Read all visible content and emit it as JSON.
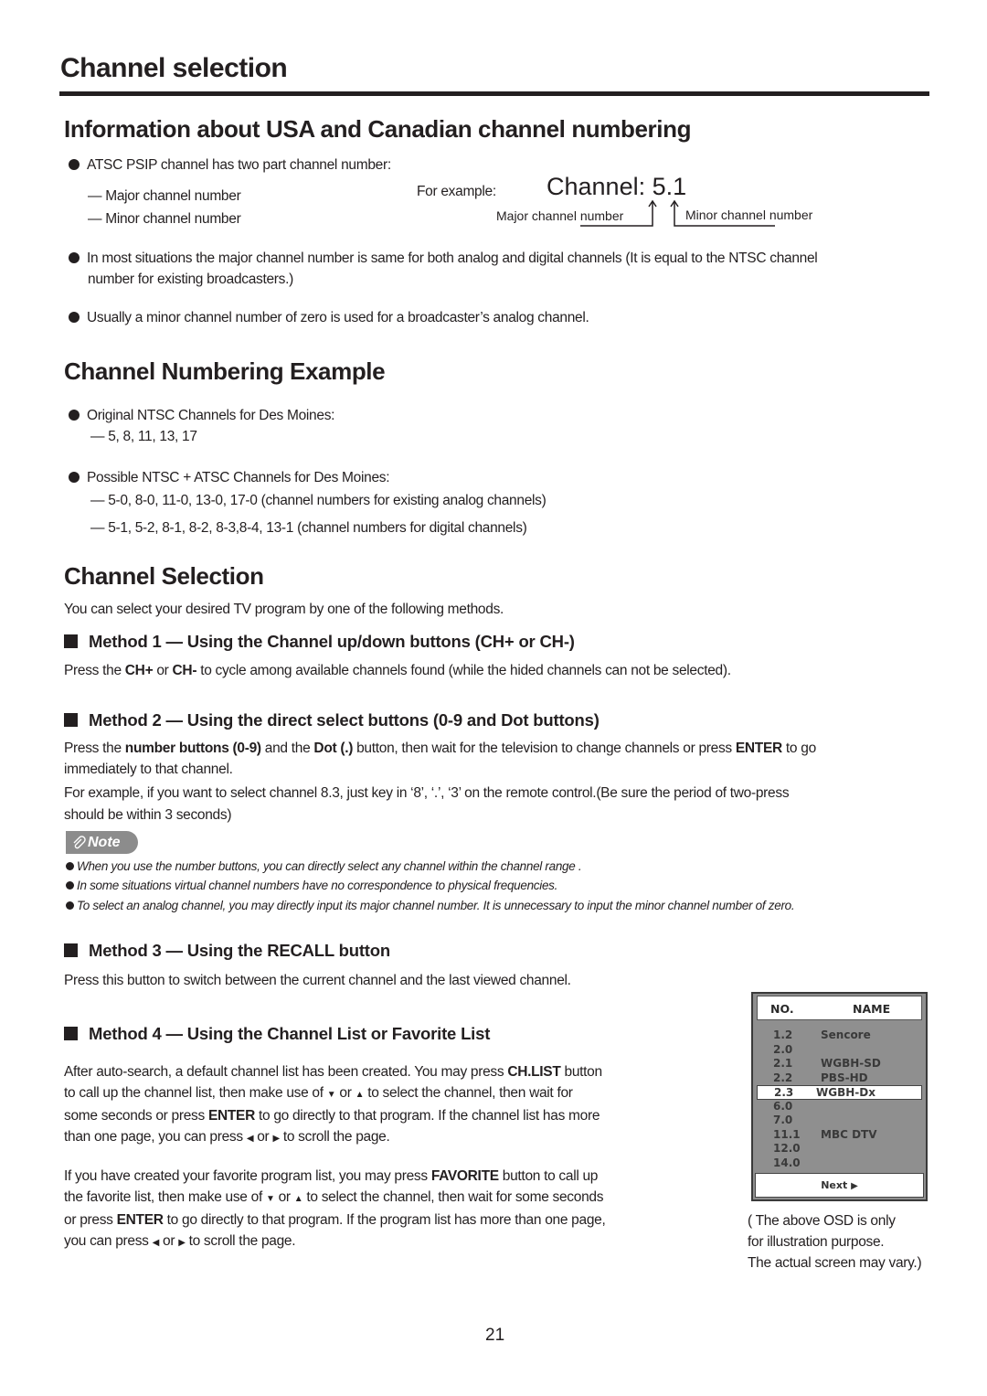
{
  "page": {
    "title": "Channel selection",
    "page_number": "21"
  },
  "section1": {
    "heading": "Information about USA and Canadian channel numbering",
    "bullet1": "ATSC PSIP channel has two part channel number:",
    "dash1": "— Major channel number",
    "dash2": "—  Minor channel number",
    "example_label": "For example:",
    "example_value": "Channel: 5.1",
    "major_label": "Major channel number",
    "minor_label": "Minor channel number",
    "bullet2_line1": "In most situations the major channel number is same for both analog and digital channels (It is equal to the NTSC channel",
    "bullet2_line2": "number for existing broadcasters.)",
    "bullet3": "Usually a minor channel number of zero is used for a broadcaster’s analog channel."
  },
  "section2": {
    "heading": "Channel Numbering Example",
    "bullet1": "Original NTSC Channels for Des Moines:",
    "bullet1_dash": "— 5, 8, 11, 13, 17",
    "bullet2": "Possible NTSC + ATSC Channels for Des Moines:",
    "bullet2_dash1": "—  5-0, 8-0, 11-0, 13-0, 17-0 (channel numbers for existing analog channels)",
    "bullet2_dash2": "—  5-1, 5-2,  8-1, 8-2, 8-3,8-4, 13-1 (channel numbers for digital channels)"
  },
  "section3": {
    "heading": "Channel Selection",
    "intro": "You can select your desired TV program by one of the following methods.",
    "method1": {
      "heading": "Method 1 —  Using the Channel up/down buttons (CH+ or CH-)",
      "t1": "Press the ",
      "b1": "CH+",
      "t2": " or ",
      "b2": "CH-",
      "t3": " to cycle among available channels found (while the hided channels can not be selected)."
    },
    "method2": {
      "heading": "Method 2 —  Using the direct select buttons (0-9 and Dot buttons)",
      "t1": "Press the ",
      "b1": "number buttons (0-9)",
      "t2": " and the ",
      "b2": "Dot (.)",
      "t3": " button, then wait for the television to change channels or press ",
      "b3": "ENTER",
      "t4": " to go",
      "line2": "immediately to that channel.",
      "line3": "For example, if you want to select channel 8.3,   just key in ‘8’, ‘.’, ‘3’ on the remote control.(Be sure the period of two-press",
      "line4": "should be within 3 seconds)"
    },
    "note": {
      "badge": "Note",
      "items": [
        "When you use the number buttons, you can directly select  any channel  within the channel  range .",
        "In some situations virtual channel numbers have no correspondence to physical frequencies.",
        "To select an analog channel, you may directly input its major channel number. It is unnecessary to input the minor channel number of zero."
      ]
    },
    "method3": {
      "heading": "Method 3 —  Using the RECALL button",
      "text": "Press this button to switch between the current channel and the last viewed channel."
    },
    "method4": {
      "heading": "Method 4 —  Using the Channel List or Favorite List",
      "p1": {
        "t1": "After auto-search, a default channel list has been created. You may press ",
        "b1": "CH.LIST",
        "t2": " button",
        "l2a": "to call up the channel list,   then make use of ",
        "l2b": " or ",
        "l2c": "  to select the channel, then wait for",
        "l3a": "some seconds or press ",
        "l3b": "ENTER",
        "l3c": " to go directly to that program. If the channel list has more",
        "l4a": "than one page, you can press ",
        "l4b": " or ",
        "l4c": " to scroll the page."
      },
      "p2": {
        "t1": "If you have created your favorite program list, you may press ",
        "b1": "FAVORITE",
        "t2": " button to call up",
        "l2a": "the favorite list,  then make use of ",
        "l2b": " or ",
        "l2c": "  to select the channel, then wait for some seconds",
        "l3a": "or press ",
        "l3b": "ENTER",
        "l3c": " to go directly to that program. If the program list has more than one page,",
        "l4a": "you can press ",
        "l4b": " or ",
        "l4c": " to scroll the page."
      }
    }
  },
  "icons": {
    "down": "▼",
    "up": "▲",
    "left": "◀",
    "right": "▶"
  },
  "osd": {
    "col_no": "NO.",
    "col_name": "NAME",
    "rows": [
      {
        "no": "1.2",
        "name": "Sencore"
      },
      {
        "no": "2.0",
        "name": ""
      },
      {
        "no": "2.1",
        "name": "WGBH-SD"
      },
      {
        "no": "2.2",
        "name": "PBS-HD"
      },
      {
        "no": "2.3",
        "name": "WGBH-Dx",
        "selected": true
      },
      {
        "no": "6.0",
        "name": ""
      },
      {
        "no": "7.0",
        "name": ""
      },
      {
        "no": "11.1",
        "name": "MBC DTV"
      },
      {
        "no": "12.0",
        "name": ""
      },
      {
        "no": "14.0",
        "name": ""
      }
    ],
    "next_label": "Next",
    "caption1": "( The above OSD is only",
    "caption2": "for illustration purpose.",
    "caption3": "The actual screen may vary.)"
  }
}
